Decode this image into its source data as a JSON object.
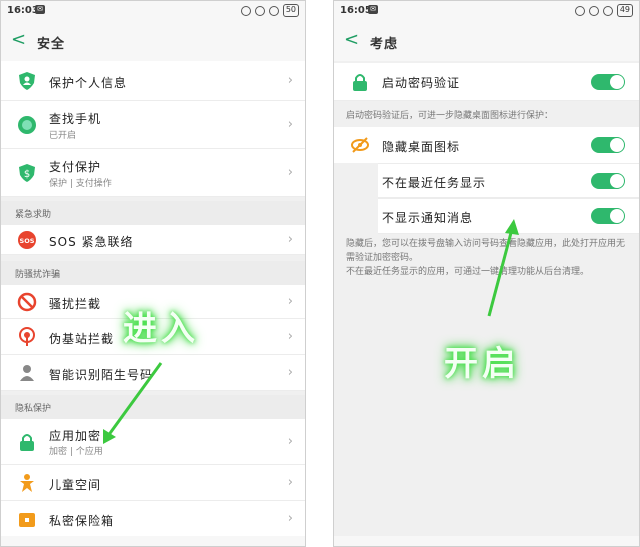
{
  "left": {
    "status": {
      "time": "16:03",
      "battery": "50"
    },
    "title": "安全",
    "items": [
      {
        "title": "保护个人信息",
        "sub": ""
      },
      {
        "title": "查找手机",
        "sub": "已开启"
      },
      {
        "title": "支付保护",
        "sub": "保护 | 支付操作"
      }
    ],
    "sec_emergency": "紧急求助",
    "sos": {
      "title": "SOS 紧急联络"
    },
    "sec_harass": "防骚扰诈骗",
    "harass_items": [
      {
        "title": "骚扰拦截"
      },
      {
        "title": "伪基站拦截"
      },
      {
        "title": "智能识别陌生号码"
      }
    ],
    "sec_privacy": "隐私保护",
    "privacy_items": [
      {
        "title": "应用加密",
        "sub": "加密 | 个应用"
      },
      {
        "title": "儿童空间",
        "sub": ""
      },
      {
        "title": "私密保险箱",
        "sub": ""
      }
    ],
    "overlay": "进入"
  },
  "right": {
    "status": {
      "time": "16:05",
      "battery": "49"
    },
    "title": "考虑",
    "password_label": "启动密码验证",
    "section_note": "启动密码验证后，可进一步隐藏桌面图标进行保护：",
    "hide_label": "隐藏桌面图标",
    "recent_label": "不在最近任务显示",
    "notify_label": "不显示通知消息",
    "desc_1": "隐藏后，您可以在拨号盘输入访问号码查看隐藏应用，此处打开应用无需验证加密密码。",
    "desc_2": "不在最近任务显示的应用，可通过一键清理功能从后台清理。",
    "overlay": "开启"
  },
  "colors": {
    "accent": "#2fb86d",
    "arrow": "#3cc93f"
  }
}
